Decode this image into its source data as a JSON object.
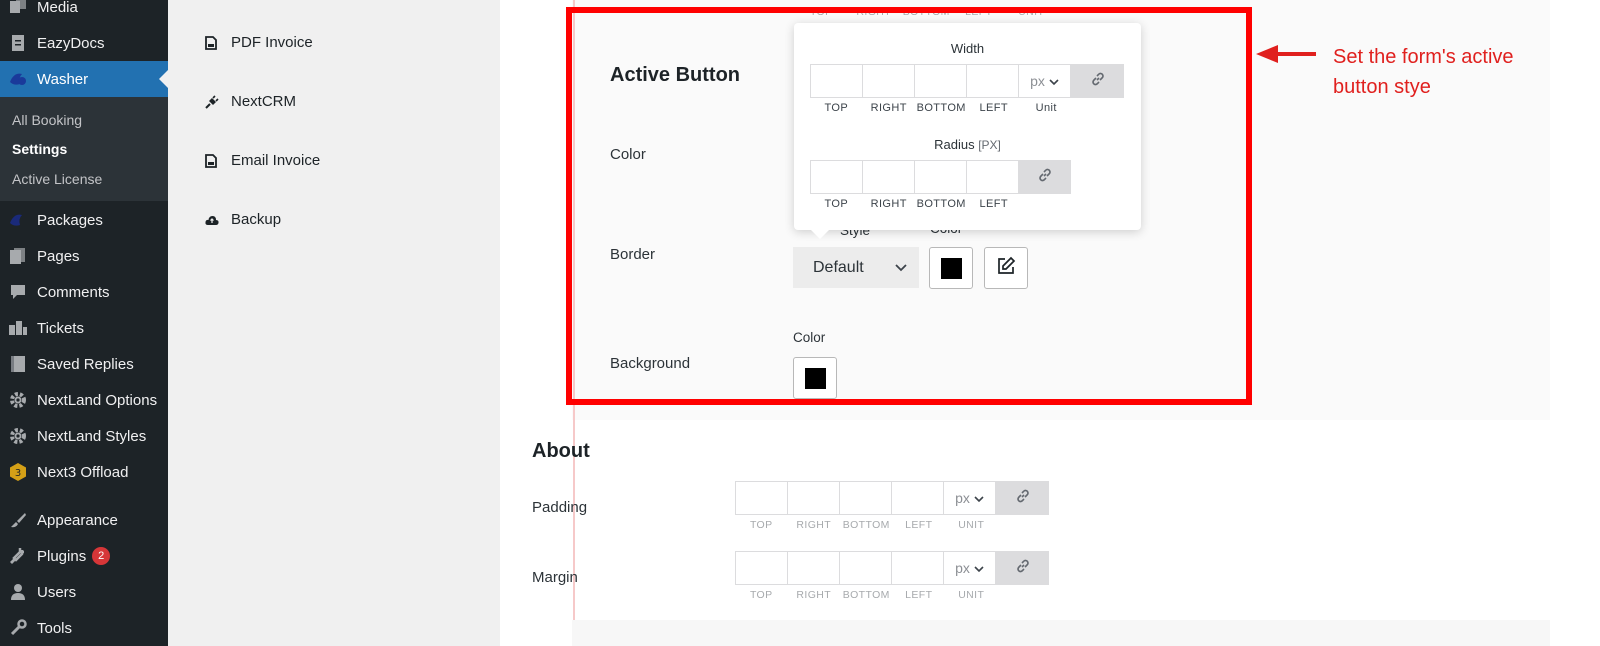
{
  "sidebar": {
    "items": [
      {
        "label": "Media",
        "icon": "media-icon"
      },
      {
        "label": "EazyDocs",
        "icon": "document-icon"
      },
      {
        "label": "Washer",
        "icon": "washer-icon",
        "active": true
      },
      {
        "label": "Packages",
        "icon": "packages-icon"
      },
      {
        "label": "Pages",
        "icon": "pages-icon"
      },
      {
        "label": "Comments",
        "icon": "comments-icon"
      },
      {
        "label": "Tickets",
        "icon": "tickets-icon"
      },
      {
        "label": "Saved Replies",
        "icon": "saved-replies-icon"
      },
      {
        "label": "NextLand Options",
        "icon": "gear-icon"
      },
      {
        "label": "NextLand Styles",
        "icon": "gear-icon"
      },
      {
        "label": "Next3 Offload",
        "icon": "next3-icon"
      },
      {
        "label": "Appearance",
        "icon": "paintbrush-icon"
      },
      {
        "label": "Plugins",
        "icon": "plugin-icon",
        "badge": "2"
      },
      {
        "label": "Users",
        "icon": "users-icon"
      },
      {
        "label": "Tools",
        "icon": "tools-icon"
      }
    ],
    "submenu": [
      {
        "label": "All Booking"
      },
      {
        "label": "Settings",
        "current": true
      },
      {
        "label": "Active License"
      }
    ]
  },
  "settings_nav": {
    "items": [
      {
        "label": "PDF Invoice",
        "icon": "file-icon"
      },
      {
        "label": "NextCRM",
        "icon": "plug-icon"
      },
      {
        "label": "Email Invoice",
        "icon": "file-icon"
      },
      {
        "label": "Backup",
        "icon": "cloud-icon"
      }
    ]
  },
  "active_button": {
    "title": "Active Button",
    "color_label": "Color",
    "border_label": "Border",
    "background_label": "Background",
    "border_style_label": "Style",
    "border_color_label": "Color",
    "border_style_value": "Default",
    "border_color": "#000000",
    "background_color_label": "Color",
    "background_color": "#000000"
  },
  "popover": {
    "width_title": "Width",
    "radius_title": "Radius",
    "radius_unit_note": "[PX]",
    "unit_value": "px",
    "width_labels": [
      "TOP",
      "RIGHT",
      "BOTTOM",
      "LEFT",
      "Unit"
    ],
    "radius_labels": [
      "TOP",
      "RIGHT",
      "BOTTOM",
      "LEFT"
    ]
  },
  "about": {
    "title": "About",
    "padding_label": "Padding",
    "margin_label": "Margin",
    "unit_value": "px",
    "dim_labels": [
      "TOP",
      "RIGHT",
      "BOTTOM",
      "LEFT",
      "UNIT"
    ]
  },
  "annotation": {
    "text": "Set the form's active button stye",
    "color": "#e0201e"
  }
}
